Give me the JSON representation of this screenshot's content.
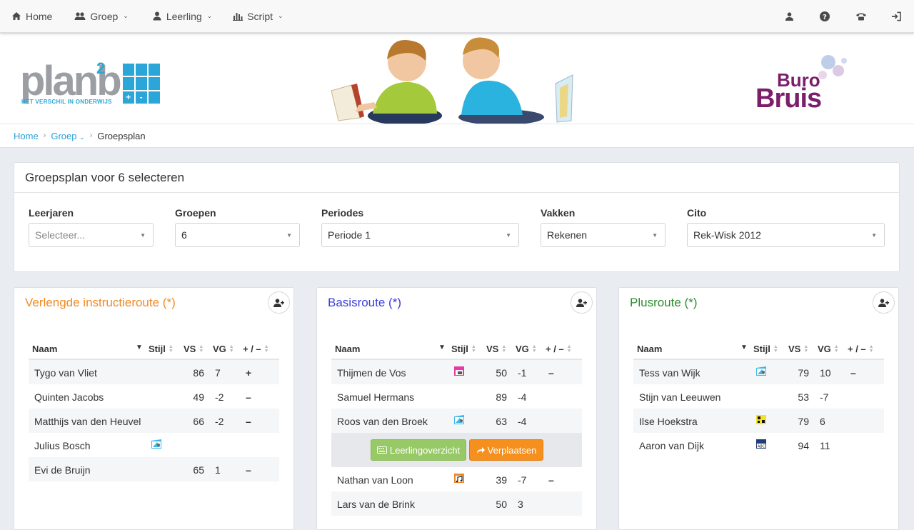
{
  "nav": {
    "left": [
      {
        "label": "Home",
        "icon": "home-icon",
        "dropdown": false
      },
      {
        "label": "Groep",
        "icon": "users-icon",
        "dropdown": true
      },
      {
        "label": "Leerling",
        "icon": "user-icon",
        "dropdown": true
      },
      {
        "label": "Script",
        "icon": "bar-chart-icon",
        "dropdown": true
      }
    ],
    "right_icons": [
      "user-icon",
      "help-icon",
      "phone-icon",
      "sign-out-icon"
    ]
  },
  "banner": {
    "logo_left_text": "plan",
    "logo_left_letter": "b",
    "logo_left_sup": "2",
    "logo_left_tagline": "HÉT VERSCHIL IN ONDERWIJS",
    "logo_grid_symbols": [
      "+",
      "-"
    ],
    "logo_right_line1": "Buro",
    "logo_right_line2": "Bruis"
  },
  "breadcrumb": {
    "home": "Home",
    "groep": "Groep",
    "current": "Groepsplan"
  },
  "selection": {
    "title": "Groepsplan voor 6 selecteren",
    "filters": [
      {
        "label": "Leerjaren",
        "value": "Selecteer...",
        "placeholder": true
      },
      {
        "label": "Groepen",
        "value": "6",
        "placeholder": false
      },
      {
        "label": "Periodes",
        "value": "Periode 1",
        "placeholder": false
      },
      {
        "label": "Vakken",
        "value": "Rekenen",
        "placeholder": false
      },
      {
        "label": "Cito",
        "value": "Rek-Wisk 2012",
        "placeholder": false
      }
    ]
  },
  "table_headers": {
    "naam": "Naam",
    "stijl": "Stijl",
    "vs": "VS",
    "vg": "VG",
    "pm": "+ / –"
  },
  "colors": {
    "verlengde": "#f08a24",
    "basis": "#3a3fd8",
    "plus": "#2e8b2e",
    "link": "#2a9fd6"
  },
  "routes": [
    {
      "title": "Verlengde instructieroute (*)",
      "rows": [
        {
          "naam": "Tygo van Vliet",
          "stijl": "",
          "vs": "86",
          "vg": "7",
          "pm": "+"
        },
        {
          "naam": "Quinten Jacobs",
          "stijl": "",
          "vs": "49",
          "vg": "-2",
          "pm": "–"
        },
        {
          "naam": "Matthijs van den Heuvel",
          "stijl": "",
          "vs": "66",
          "vg": "-2",
          "pm": "–"
        },
        {
          "naam": "Julius Bosch",
          "stijl": "visual-style-icon",
          "vs": "",
          "vg": "",
          "pm": ""
        },
        {
          "naam": "Evi de Bruijn",
          "stijl": "",
          "vs": "65",
          "vg": "1",
          "pm": "–"
        }
      ]
    },
    {
      "title": "Basisroute (*)",
      "rows": [
        {
          "naam": "Thijmen de Vos",
          "stijl": "kinesthetic-style-icon",
          "vs": "50",
          "vg": "-1",
          "pm": "–"
        },
        {
          "naam": "Samuel Hermans",
          "stijl": "",
          "vs": "89",
          "vg": "-4",
          "pm": ""
        },
        {
          "naam": "Roos van den Broek",
          "stijl": "visual-style-icon",
          "vs": "63",
          "vg": "-4",
          "pm": ""
        },
        {
          "naam": "Nathan van Loon",
          "stijl": "music-style-icon",
          "vs": "39",
          "vg": "-7",
          "pm": "–"
        },
        {
          "naam": "Lars van de Brink",
          "stijl": "",
          "vs": "50",
          "vg": "3",
          "pm": ""
        }
      ],
      "actions": {
        "leerlingoverzicht": "Leerlingoverzicht",
        "verplaatsen": "Verplaatsen"
      }
    },
    {
      "title": "Plusroute (*)",
      "rows": [
        {
          "naam": "Tess van Wijk",
          "stijl": "visual-style-icon",
          "vs": "79",
          "vg": "10",
          "pm": "–"
        },
        {
          "naam": "Stijn van Leeuwen",
          "stijl": "",
          "vs": "53",
          "vg": "-7",
          "pm": ""
        },
        {
          "naam": "Ilse Hoekstra",
          "stijl": "logic-style-icon",
          "vs": "79",
          "vg": "6",
          "pm": ""
        },
        {
          "naam": "Aaron van Dijk",
          "stijl": "verbal-style-icon",
          "vs": "94",
          "vg": "11",
          "pm": ""
        }
      ]
    }
  ]
}
